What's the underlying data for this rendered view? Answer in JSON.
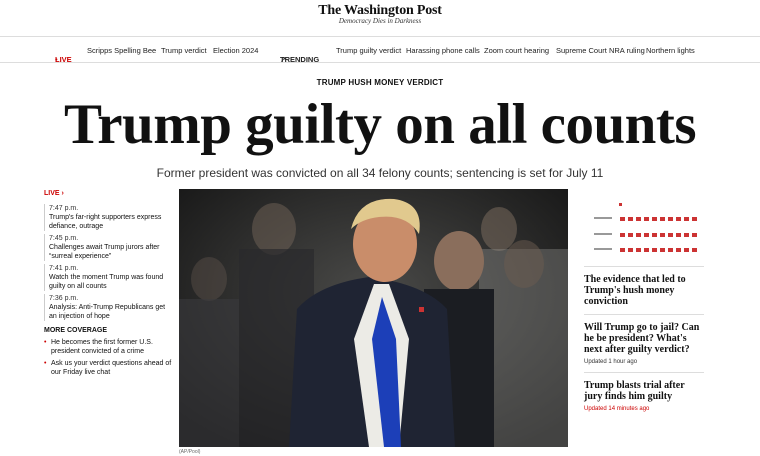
{
  "masthead": {
    "logo": "The Washington Post",
    "tagline": "Democracy Dies in Darkness"
  },
  "nav": {
    "live_label": "LIVE",
    "links": [
      "Scripps Spelling Bee",
      "Trump verdict",
      "Election 2024"
    ],
    "trending_label": "TRENDING",
    "trending_links": [
      "Trump guilty verdict",
      "Harassing phone calls",
      "Zoom court hearing",
      "Supreme Court NRA ruling",
      "Northern lights"
    ]
  },
  "article": {
    "kicker": "TRUMP HUSH MONEY VERDICT",
    "headline": "Trump guilty on all counts",
    "dek": "Former president was convicted on all 34 felony counts; sentencing is set for July 11",
    "photo_credit": "(AP/Pool)"
  },
  "live_rail": {
    "label": "LIVE",
    "items": [
      {
        "time": "7:47 p.m.",
        "text": "Trump's far-right supporters express defiance, outrage"
      },
      {
        "time": "7:45 p.m.",
        "text": "Challenges await Trump jurors after “surreal experience”"
      },
      {
        "time": "7:41 p.m.",
        "text": "Watch the moment Trump was found guilty on all counts"
      },
      {
        "time": "7:36 p.m.",
        "text": "Analysis: Anti-Trump Republicans get an injection of hope"
      }
    ],
    "more_label": "MORE COVERAGE",
    "more": [
      "He becomes the first former U.S. president convicted of a crime",
      "Ask us your verdict questions ahead of our Friday live chat"
    ]
  },
  "right_rail": {
    "stories": [
      {
        "title": "The evidence that led to Trump's hush money conviction",
        "updated": ""
      },
      {
        "title": "Will Trump go to jail? Can he be president? What's next after guilty verdict?",
        "updated": "Updated 1 hour ago"
      },
      {
        "title": "Trump blasts trial after jury finds him guilty",
        "updated": "Updated 14 minutes ago"
      }
    ]
  },
  "colors": {
    "accent": "#cc0000",
    "text": "#111111"
  }
}
